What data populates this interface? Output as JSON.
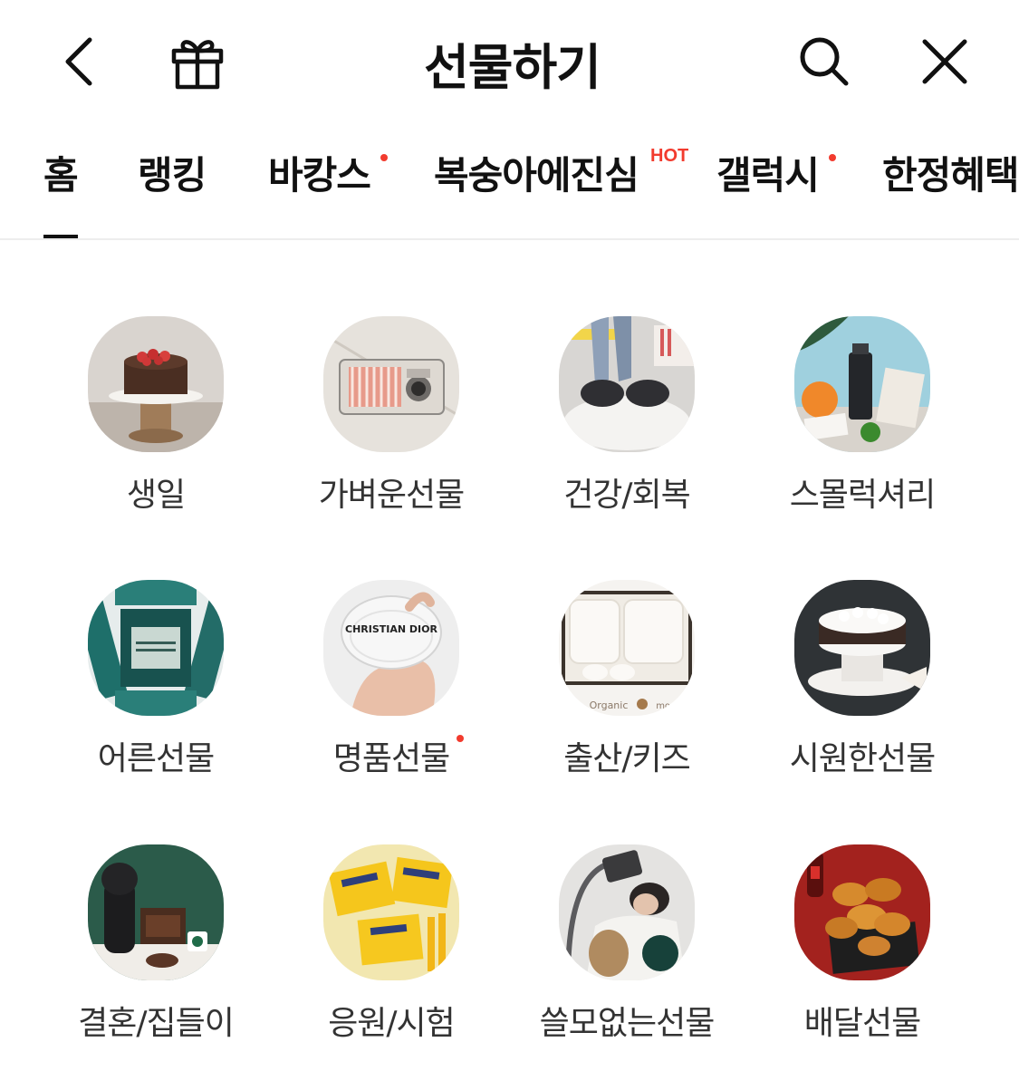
{
  "header": {
    "title": "선물하기",
    "back_icon": "chevron-left-icon",
    "gift_icon": "gift-box-icon",
    "search_icon": "search-icon",
    "close_icon": "close-icon"
  },
  "tabs": [
    {
      "label": "홈",
      "active": true
    },
    {
      "label": "랭킹"
    },
    {
      "label": "바캉스",
      "new_dot": true
    },
    {
      "label": "복숭아에진심",
      "badge": "HOT"
    },
    {
      "label": "갤럭시",
      "new_dot": true
    },
    {
      "label": "한정혜택"
    }
  ],
  "categories": [
    {
      "label": "생일"
    },
    {
      "label": "가벼운선물"
    },
    {
      "label": "건강/회복"
    },
    {
      "label": "스몰럭셔리"
    },
    {
      "label": "어른선물"
    },
    {
      "label": "명품선물",
      "new_dot": true
    },
    {
      "label": "출산/키즈"
    },
    {
      "label": "시원한선물"
    },
    {
      "label": "결혼/집들이"
    },
    {
      "label": "응원/시험"
    },
    {
      "label": "쓸모없는선물"
    },
    {
      "label": "배달선물"
    }
  ],
  "colors": {
    "accent": "#f23b2e",
    "text": "#111111",
    "label": "#333333"
  }
}
